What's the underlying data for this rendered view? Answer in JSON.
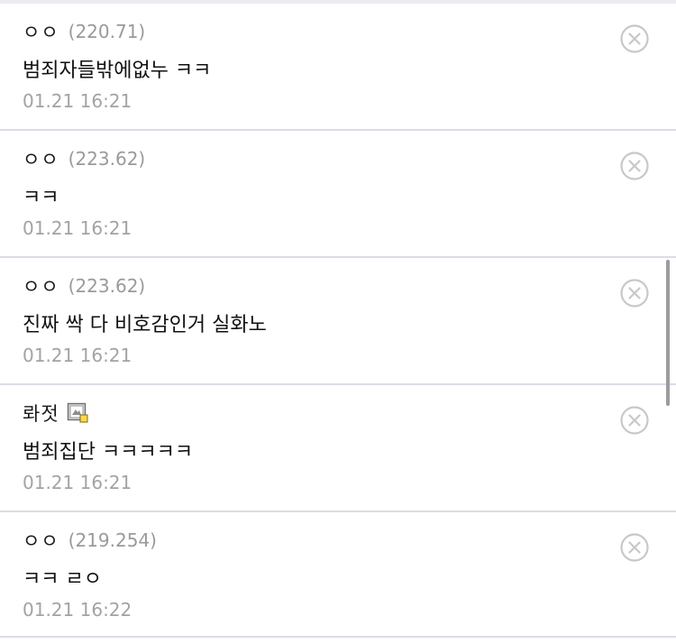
{
  "comments": [
    {
      "nick": "ㅇㅇ",
      "ip": "(220.71)",
      "body": "범죄자들밖에없누 ㅋㅋ",
      "date": "01.21 16:21",
      "fixed_icon": false
    },
    {
      "nick": "ㅇㅇ",
      "ip": "(223.62)",
      "body": "ㅋㅋ",
      "date": "01.21 16:21",
      "fixed_icon": false
    },
    {
      "nick": "ㅇㅇ",
      "ip": "(223.62)",
      "body": "진짜 싹 다 비호감인거 실화노",
      "date": "01.21 16:21",
      "fixed_icon": false
    },
    {
      "nick": "롸젓",
      "ip": "",
      "body": "범죄집단 ㅋㅋㅋㅋㅋ",
      "date": "01.21 16:21",
      "fixed_icon": true
    },
    {
      "nick": "ㅇㅇ",
      "ip": "(219.254)",
      "body": "ㅋㅋ ㄹㅇ",
      "date": "01.21 16:22",
      "fixed_icon": false
    }
  ],
  "icons": {
    "delete": "close-circle-icon",
    "member": "fixed-nick-icon"
  },
  "colors": {
    "separator": "#dcdce6",
    "ip_text": "#9a9a9a",
    "date_text": "#a3a3a3",
    "delete_icon": "#c8c8c8"
  }
}
